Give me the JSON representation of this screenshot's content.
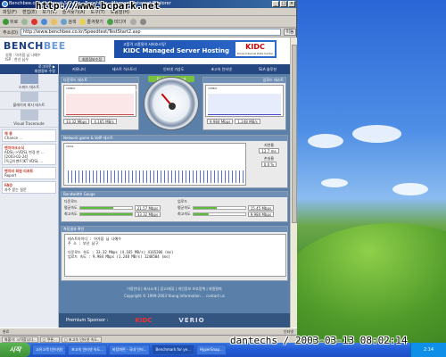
{
  "window": {
    "title": "Benchbee.co.kr Internet Service - Benchbee - Microsoft Internet Explorer",
    "menu": [
      "파일(F)",
      "편집(E)",
      "보기(V)",
      "즐겨찾기(A)",
      "도구(T)",
      "도움말(H)"
    ],
    "toolbar": [
      "뒤로",
      "검색",
      "즐겨찾기",
      "미디어"
    ],
    "address_label": "주소(D)",
    "address": "http://www.benchbee.co.kr/Speedtest/TestStart2.asp",
    "go": "이동",
    "status_text": "완료",
    "status_zone": "인터넷"
  },
  "site": {
    "logo_main": "BENCH",
    "logo_accent": "BEE",
    "info_line1": "성명 : 아가잠 님 나예수",
    "info_line2": "ISP : 한선 남우",
    "login_label": "회원정보수정",
    "banner_small": "고품격 고품질의 서버호스팅!",
    "banner_big": "KIDC Managed Server Hosting",
    "banner_logo": "KIDC",
    "banner_logo_sub": "Korea Internet Data Center",
    "nav": [
      "커뮤니티",
      "테스트 히스토리",
      "인터넷 기상도",
      "초고속 인터넷",
      "SLA 솔루션"
    ]
  },
  "sidebar": {
    "top_line1": "로그아웃 ▶",
    "top_line2": "회원정보 수정",
    "items": [
      "스피드 테스트",
      "블레이저 회사 테스트",
      "Visual Traceroute"
    ],
    "box1_head": "채 용",
    "box1_text": "Chance ...",
    "box2_head": "벤치마크소식",
    "box2_text": "ADSL->VDSL 변경 한 ...",
    "box3_head": "[2003-02-24]",
    "box3_text": "[독금이벤트]KT VDSL ...",
    "box4_head": "벤치비 회원 리포트",
    "box4_text": "Report",
    "box5_head": "FAQ",
    "box5_text": "자주 묻는 질문"
  },
  "speed": {
    "download_title": "다운로드 테스트",
    "upload_title": "업로드 테스트",
    "graph_top": "10Mbit",
    "download_mbps": "33.32 Mbps",
    "download_mbs": "4.165 MB/s",
    "upload_mbps": "9.984 Mbps",
    "upload_mbs": "1.248 MB/s",
    "gauge_badge": "Fiy Range  speed",
    "gauge_label": "VOD Capability"
  },
  "network": {
    "title": "Network game & VoIP 테스트",
    "graph_top": "10ms",
    "latency_label": "지연율",
    "latency_value": "12.7 ms",
    "loss_label": "손실율",
    "loss_value": "0.0 %"
  },
  "bandwidth": {
    "title": "Bandwidth Gauge",
    "down_head": "다운로드",
    "up_head": "업로드",
    "down_rows": [
      {
        "label": "평균속도",
        "value": "21.57 Mbps",
        "fill": 0.64
      },
      {
        "label": "최고속도",
        "value": "33.32 Mbps",
        "fill": 1.0
      }
    ],
    "up_rows": [
      {
        "label": "평균속도",
        "value": "15.45 Mbps",
        "fill": 0.46
      },
      {
        "label": "최고속도",
        "value": "9.984 Mbps",
        "fill": 0.3
      }
    ]
  },
  "result": {
    "title": "측정결과 확인",
    "lines": [
      "테스트아이디 :   아가잠 님 나예수",
      "주   소      :   부산 남구",
      "",
      "다운로드 속도 :  33.32 Mbps (4.165 MB/s) 4165206 (ms)",
      "업로드 속도   :  9.984 Mbps (1.248 MB/s) 1248504 (ms)"
    ]
  },
  "footer": {
    "links": "이용안내 | 회사소개 | 광고/제휴 | 개인정보 보호정책 | 회원탈퇴",
    "copy": "Copyright © 1999-2003 Young Information ...  contact us",
    "sponsor_label": "Premium Sponsor :",
    "sponsor1": "KIDC",
    "sponsor2": "VERIO"
  },
  "bottom_tasks": [
    "화풀이: 시작합니다..",
    "□ 쿠폰... ",
    "□ 초고속 인터넷 속도.."
  ],
  "taskbar": {
    "start": "시작",
    "tasks": [
      "고유고객 (인터넷)",
      "초고속 인터넷 속도...",
      "바탕화면 - 국내 인터...",
      "Benchmark for ye...",
      "HyperSnap..."
    ],
    "tray": "2:14"
  },
  "watermarks": {
    "url": "http://www.bcpark.net",
    "date": "dantechs / 2003-03-13 08:02:14"
  },
  "colors": {
    "nav_blue": "#254781",
    "panel_blue": "#5a7fa8",
    "titlebar": "#0a246a"
  }
}
